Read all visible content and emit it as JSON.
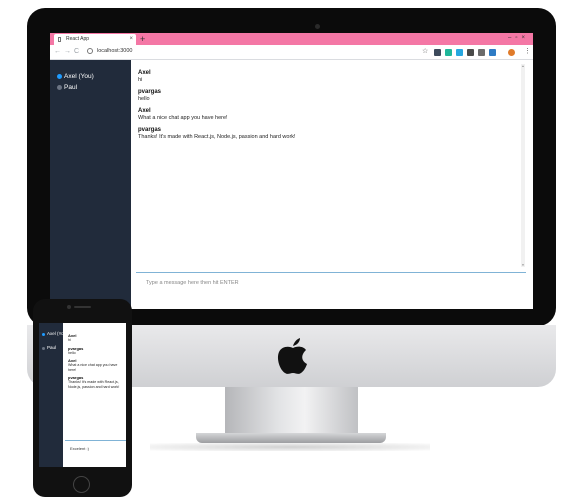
{
  "browser": {
    "tab_title": "React App",
    "tab_close": "×",
    "new_tab": "+",
    "window_controls": "–▫×",
    "back": "←",
    "forward": "→",
    "reload": "C",
    "url": "localhost:3000",
    "star": "☆",
    "menu": "⋮",
    "extension_colors": [
      "#3d4a5c",
      "#1fb79a",
      "#27a7e0",
      "#4a4a4a",
      "#6b6b6b",
      "#2e7bc4",
      "#e07b2a"
    ]
  },
  "users": [
    {
      "name": "Axel (You)",
      "color": "#1e9bff"
    },
    {
      "name": "Paul",
      "color": "#6b7483"
    }
  ],
  "messages": [
    {
      "author": "Axel",
      "text": "hi"
    },
    {
      "author": "pvargas",
      "text": "hello"
    },
    {
      "author": "Axel",
      "text": "What a nice chat app you have here!"
    },
    {
      "author": "pvargas",
      "text": "Thanks! It's made with React.js, Node.js, passion and hard work!"
    }
  ],
  "input_placeholder": "Type a message here then hit ENTER",
  "mobile": {
    "users": [
      {
        "name": "Axel (Yo)",
        "color": "#1e9bff"
      },
      {
        "name": "Paul",
        "color": "#6b7483"
      }
    ],
    "messages": [
      {
        "author": "Axel",
        "text": "hi"
      },
      {
        "author": "pvargas",
        "text": "hello"
      },
      {
        "author": "Axel",
        "text": "What a nice chat app you have here!"
      },
      {
        "author": "pvargas",
        "text": "Thanks! It's made with React.js, Node.js, passion and hard work!"
      }
    ],
    "input_value": "Excelent :)"
  },
  "colors": {
    "tab_strip": "#f477a5",
    "sidebar": "#212b3b",
    "input_border": "#80b3d6"
  }
}
